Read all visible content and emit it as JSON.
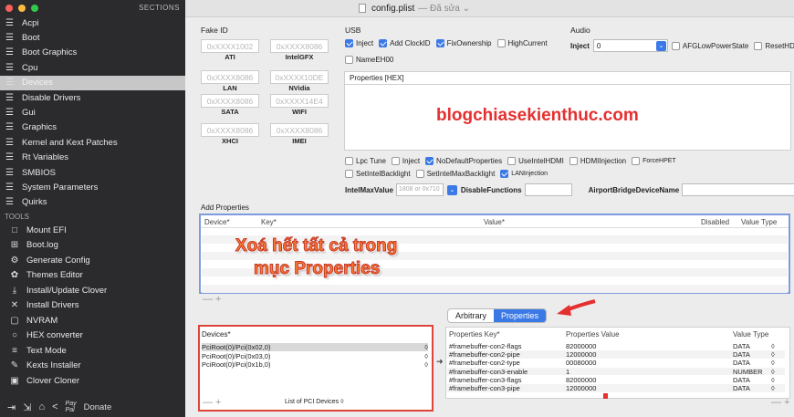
{
  "window": {
    "title": "config.plist",
    "subtitle": "— Đã sửa ⌄"
  },
  "sidebar": {
    "header": "SECTIONS",
    "sections": [
      "Acpi",
      "Boot",
      "Boot Graphics",
      "Cpu",
      "Devices",
      "Disable Drivers",
      "Gui",
      "Graphics",
      "Kernel and Kext Patches",
      "Rt Variables",
      "SMBIOS",
      "System Parameters",
      "Quirks"
    ],
    "tools_header": "TOOLS",
    "tools": [
      "Mount EFI",
      "Boot.log",
      "Generate Config",
      "Themes Editor",
      "Install/Update Clover",
      "Install Drivers",
      "NVRAM",
      "HEX converter",
      "Text Mode",
      "Kexts Installer",
      "Clover Cloner"
    ],
    "donate": "Donate"
  },
  "fake_id": {
    "title": "Fake ID",
    "items": [
      {
        "value": "0xXXXX1002",
        "label": "ATI"
      },
      {
        "value": "0xXXXX8086",
        "label": "IntelGFX"
      },
      {
        "value": "0xXXXX8086",
        "label": "LAN"
      },
      {
        "value": "0xXXXX10DE",
        "label": "NVidia"
      },
      {
        "value": "0xXXXX8086",
        "label": "SATA"
      },
      {
        "value": "0xXXXX14E4",
        "label": "WIFI"
      },
      {
        "value": "0xXXXX8086",
        "label": "XHCI"
      },
      {
        "value": "0xXXXX8086",
        "label": "IMEI"
      }
    ]
  },
  "usb": {
    "title": "USB",
    "inject": "Inject",
    "add_clockid": "Add ClockID",
    "fixownership": "FixOwnership",
    "highcurrent": "HighCurrent",
    "nameeh00": "NameEH00"
  },
  "audio": {
    "title": "Audio",
    "inject_label": "Inject",
    "inject_value": "0",
    "afglowpowerstate": "AFGLowPowerState",
    "resethda": "ResetHDA"
  },
  "properties_hex": {
    "title": "Properties [HEX]"
  },
  "watermark": "blogchiasekienthuc.com",
  "options": {
    "lpc_tune": "Lpc Tune",
    "inject": "Inject",
    "nodefaultproperties": "NoDefaultProperties",
    "useintelhdmi": "UseIntelHDMI",
    "hdmiinjection": "HDMIInjection",
    "forcehpet": "ForceHPET",
    "setintelbacklight": "SetIntelBacklight",
    "setintelmaxbacklight": "SetIntelMaxBacklight",
    "laninjection": "LANInjection"
  },
  "intelmax": {
    "label": "IntelMaxValue",
    "placeholder": "1808 or 0x710",
    "disablefunctions": "DisableFunctions",
    "airportbridge": "AirportBridgeDeviceName"
  },
  "add_properties": {
    "title": "Add Properties",
    "columns": [
      "Device*",
      "Key*",
      "Value*",
      "Disabled",
      "Value Type"
    ]
  },
  "callout": {
    "line1": "Xoá hết tất cả trong",
    "line2": "mục Properties"
  },
  "tabs": {
    "arbitrary": "Arbitrary",
    "properties": "Properties"
  },
  "devices": {
    "header": "Devices*",
    "rows": [
      "PciRoot(0)/Pci(0x02,0)",
      "PciRoot(0)/Pci(0x03,0)",
      "PciRoot(0)/Pci(0x1b,0)"
    ],
    "footer": "List of PCI Devices ◊"
  },
  "props": {
    "columns": [
      "Properties Key*",
      "Properties Value",
      "Value Type"
    ],
    "rows": [
      {
        "key": "#framebuffer-con2-flags",
        "value": "82000000",
        "type": "DATA"
      },
      {
        "key": "#framebuffer-con2-pipe",
        "value": "12000000",
        "type": "DATA"
      },
      {
        "key": "#framebuffer-con2-type",
        "value": "00080000",
        "type": "DATA"
      },
      {
        "key": "#framebuffer-con3-enable",
        "value": "1",
        "type": "NUMBER"
      },
      {
        "key": "#framebuffer-con3-flags",
        "value": "82000000",
        "type": "DATA"
      },
      {
        "key": "#framebuffer-con3-pipe",
        "value": "12000000",
        "type": "DATA"
      }
    ]
  },
  "plusminus": "— +",
  "colors": {
    "accent": "#3b7ae6",
    "highlight": "#e53030",
    "sidebar": "#2b2b2e"
  }
}
